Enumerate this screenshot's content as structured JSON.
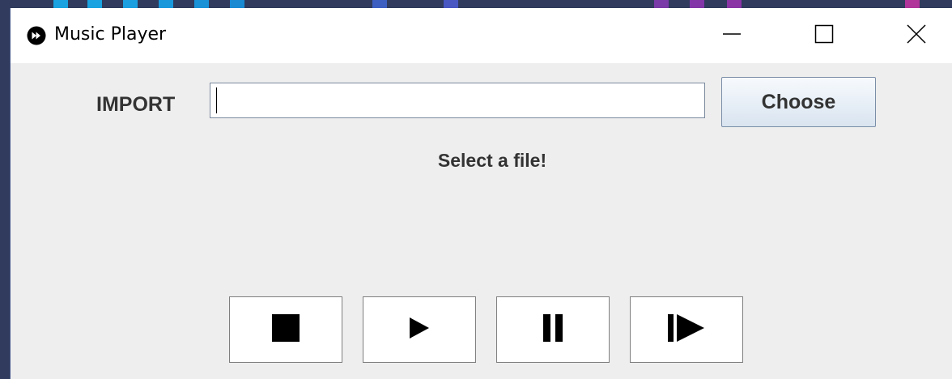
{
  "window": {
    "title": "Music Player",
    "controls": {
      "minimize": "minimize-icon",
      "maximize": "maximize-icon",
      "close": "close-icon"
    }
  },
  "import": {
    "label": "IMPORT",
    "path_value": "",
    "choose_label": "Choose"
  },
  "status": {
    "message": "Select a file!"
  },
  "playback": {
    "buttons": [
      {
        "icon": "stop-icon"
      },
      {
        "icon": "play-icon"
      },
      {
        "icon": "pause-icon"
      },
      {
        "icon": "skip-next-icon"
      }
    ]
  },
  "colors": {
    "window_bg": "#eeeeee",
    "titlebar_bg": "#ffffff",
    "text": "#333333",
    "desktop_bg": "#303b5d"
  }
}
